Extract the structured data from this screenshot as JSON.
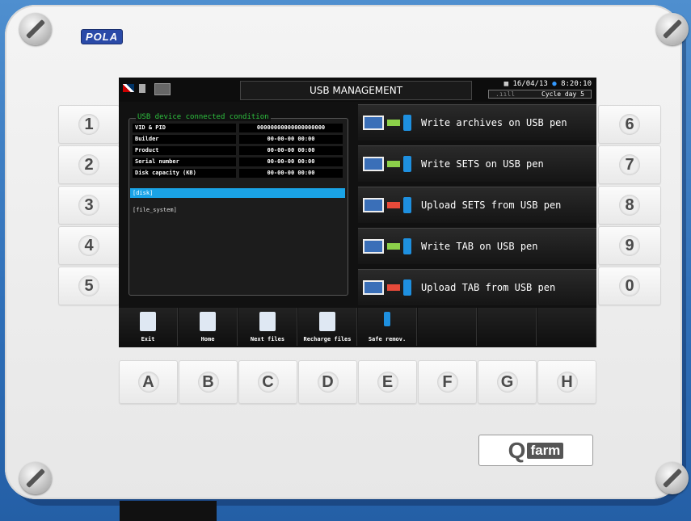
{
  "brand": "POLA",
  "screen": {
    "title": "USB MANAGEMENT",
    "date": "16/04/13",
    "time": "8:20:10",
    "cycle_label": "Cycle day 5",
    "panel_title": "USB device connected condition",
    "rows": [
      {
        "label": "VID & PID",
        "value": "00000000000000000000"
      },
      {
        "label": "Builder",
        "value": "00-00-00 00:00"
      },
      {
        "label": "Product",
        "value": "00-00-00 00:00"
      },
      {
        "label": "Serial number",
        "value": "00-00-00 00:00"
      },
      {
        "label": "Disk capacity (KB)",
        "value": "00-00-00 00:00"
      }
    ],
    "disk_label": "[disk]",
    "fs_label": "[file_system]",
    "actions": [
      {
        "label": "Write archives on USB pen",
        "direction": "write"
      },
      {
        "label": "Write SETS on USB pen",
        "direction": "write"
      },
      {
        "label": "Upload SETS from USB pen",
        "direction": "upload"
      },
      {
        "label": "Write TAB on USB pen",
        "direction": "write"
      },
      {
        "label": "Upload TAB from USB pen",
        "direction": "upload"
      }
    ],
    "softkeys": [
      "Exit",
      "Home",
      "Next files",
      "Recharge files",
      "Safe remov.",
      "",
      "",
      ""
    ]
  },
  "keys_left": [
    "1",
    "2",
    "3",
    "4",
    "5"
  ],
  "keys_right": [
    "6",
    "7",
    "8",
    "9",
    "0"
  ],
  "keys_bottom": [
    "A",
    "B",
    "C",
    "D",
    "E",
    "F",
    "G",
    "H"
  ],
  "logo": {
    "q": "Q",
    "farm": "farm"
  }
}
